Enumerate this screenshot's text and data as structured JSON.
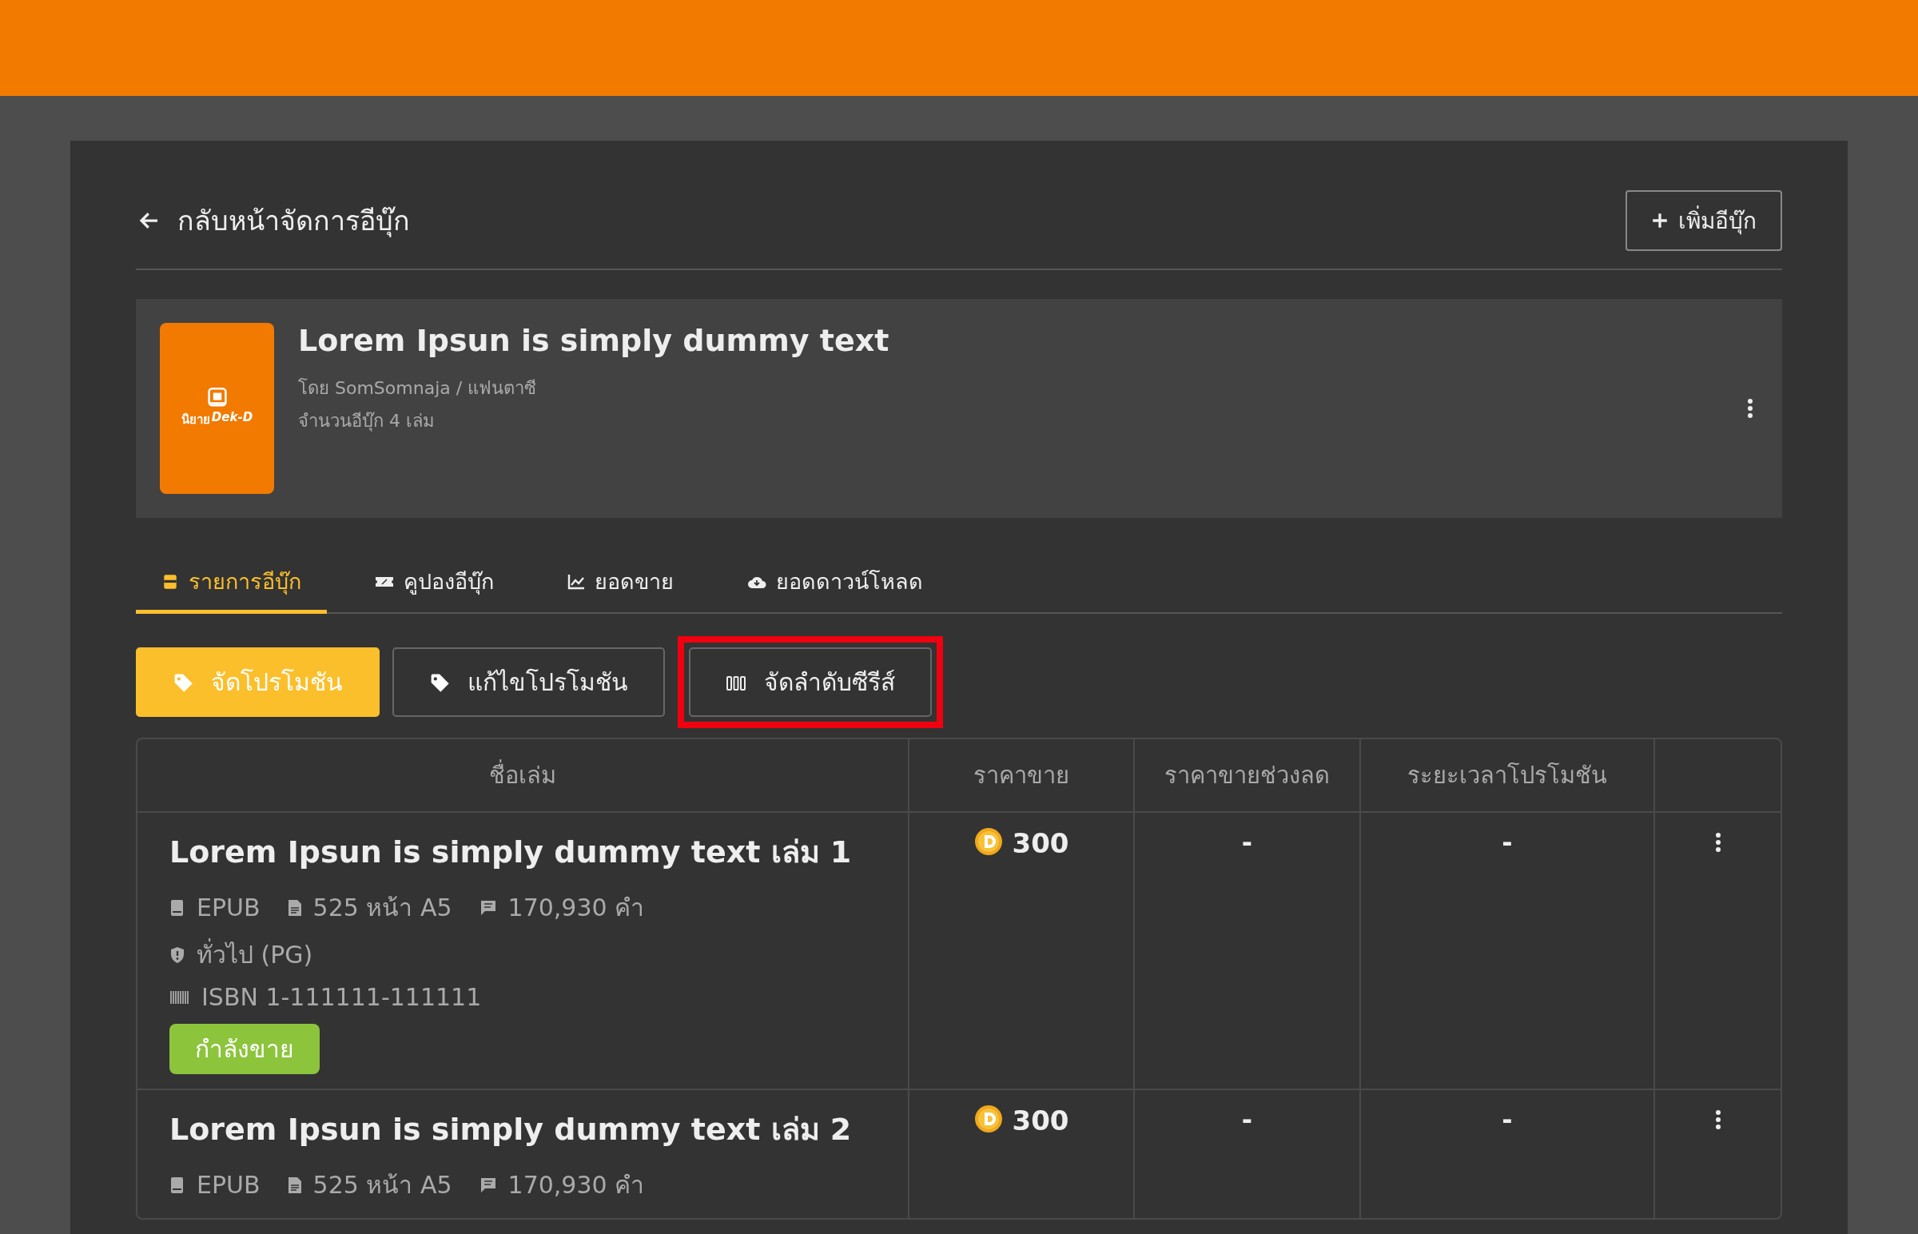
{
  "header": {
    "back_label": "กลับหน้าจัดการอีบุ๊ก",
    "add_button": "เพิ่มอีบุ๊ก"
  },
  "book": {
    "cover_logo": "นิยาย",
    "cover_brand": "Dek-D",
    "title": "Lorem Ipsun is simply dummy text",
    "byline": "โดย SomSomnaja / แฟนตาซี",
    "count": "จำนวนอีบุ๊ก 4 เล่ม"
  },
  "tabs": [
    {
      "label": "รายการอีบุ๊ก",
      "kind": "ebook",
      "selected": true
    },
    {
      "label": "คูปองอีบุ๊ก",
      "kind": "coupon",
      "selected": false
    },
    {
      "label": "ยอดขาย",
      "kind": "sales",
      "selected": false
    },
    {
      "label": "ยอดดาวน์โหลด",
      "kind": "download",
      "selected": false
    }
  ],
  "actions": [
    {
      "label": "จัดโปรโมชัน",
      "kind": "tag",
      "primary": true,
      "highlighted": false
    },
    {
      "label": "แก้ไขโปรโมชัน",
      "kind": "tag",
      "primary": false,
      "highlighted": false
    },
    {
      "label": "จัดลำดับซีรีส์",
      "kind": "sort",
      "primary": false,
      "highlighted": true
    }
  ],
  "table": {
    "columns": [
      "ชื่อเล่ม",
      "ราคาขาย",
      "ราคาขายช่วงลด",
      "ระยะเวลาโปรโมชัน"
    ],
    "rows": [
      {
        "title": "Lorem Ipsun is simply dummy text เล่ม 1",
        "format": "EPUB",
        "pages": "525 หน้า A5",
        "words": "170,930 คำ",
        "rating": "ทั่วไป (PG)",
        "isbn": "ISBN 1-111111-111111",
        "status": "กำลังขาย",
        "price": "300",
        "sale_price": "-",
        "promo_period": "-"
      },
      {
        "title": "Lorem Ipsun is simply dummy text เล่ม 2",
        "format": "EPUB",
        "pages": "525 หน้า A5",
        "words": "170,930 คำ",
        "price": "300",
        "sale_price": "-",
        "promo_period": "-"
      }
    ]
  }
}
